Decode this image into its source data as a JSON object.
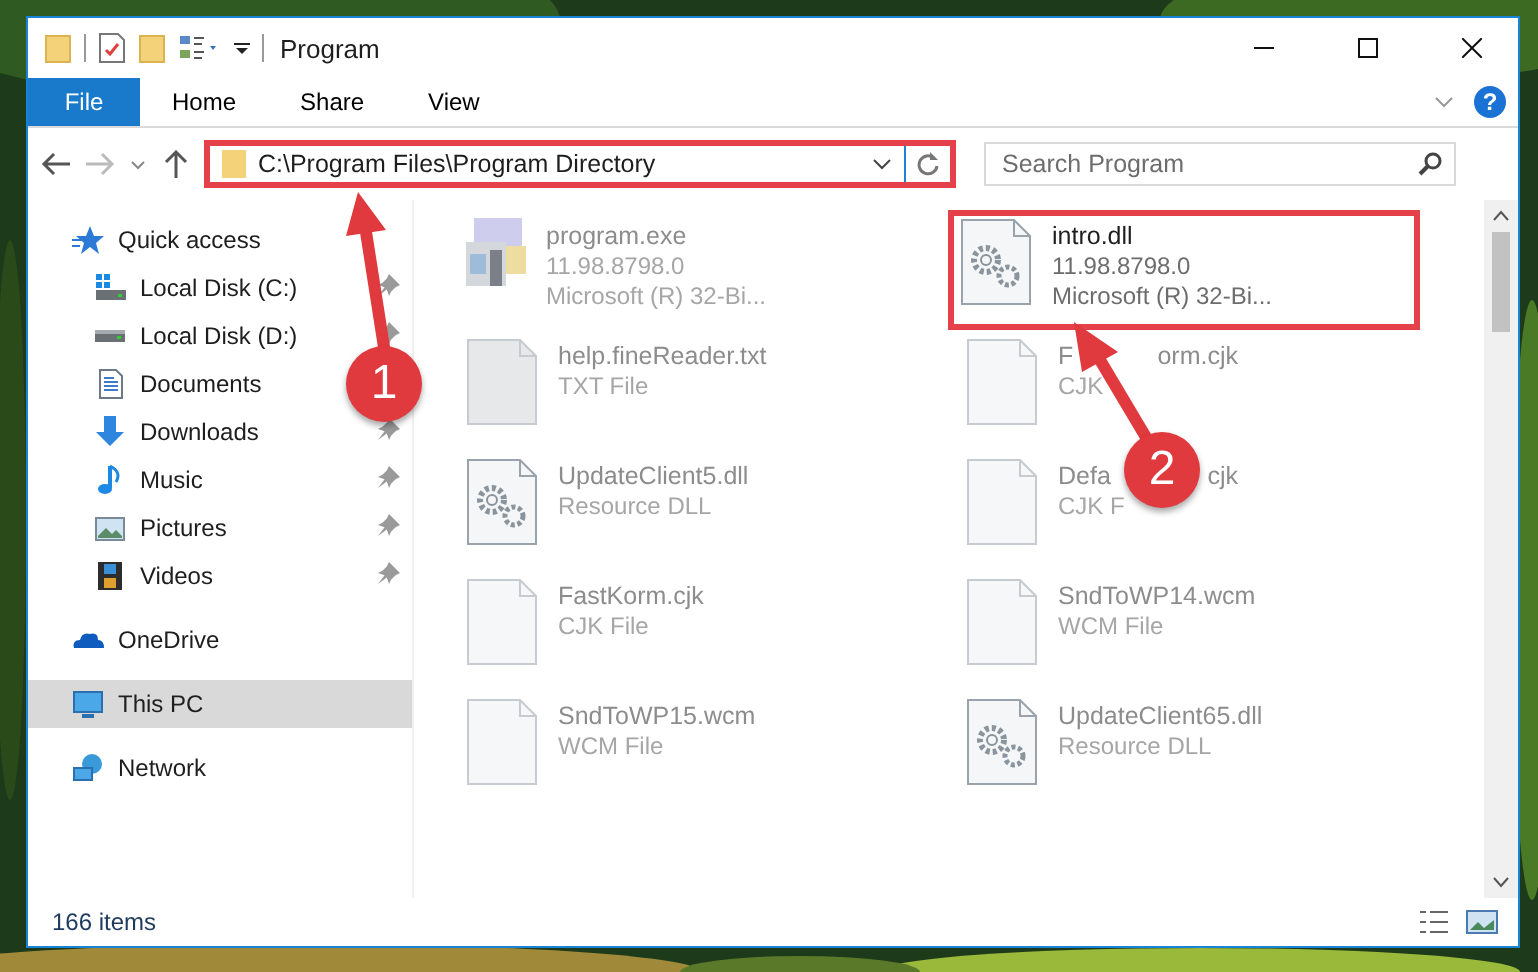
{
  "window": {
    "title": "Program"
  },
  "ribbon": {
    "tabs": [
      {
        "label": "File",
        "selected": true
      },
      {
        "label": "Home",
        "selected": false
      },
      {
        "label": "Share",
        "selected": false
      },
      {
        "label": "View",
        "selected": false
      }
    ],
    "help": "?"
  },
  "address_bar": {
    "path": "C:\\Program Files\\Program Directory",
    "highlighted": true
  },
  "search": {
    "placeholder": "Search Program"
  },
  "sidebar": {
    "items": [
      {
        "label": "Quick access",
        "kind": "star",
        "selected": false,
        "children": [
          {
            "label": "Local Disk (C:)",
            "kind": "windows-drive",
            "pinned": true,
            "selected": false
          },
          {
            "label": "Local Disk (D:)",
            "kind": "drive",
            "pinned": true,
            "selected": false
          },
          {
            "label": "Documents",
            "kind": "documents",
            "selected": false
          },
          {
            "label": "Downloads",
            "kind": "downloads",
            "pinned": true,
            "selected": false
          },
          {
            "label": "Music",
            "kind": "music",
            "pinned": true,
            "selected": false
          },
          {
            "label": "Pictures",
            "kind": "pictures",
            "pinned": true,
            "selected": false
          },
          {
            "label": "Videos",
            "kind": "videos",
            "pinned": true,
            "selected": false
          }
        ]
      },
      {
        "label": "OneDrive",
        "kind": "cloud",
        "selected": false
      },
      {
        "label": "This PC",
        "kind": "pc",
        "selected": true
      },
      {
        "label": "Network",
        "kind": "network",
        "selected": false
      }
    ]
  },
  "files": [
    {
      "name": [
        "program.exe"
      ],
      "kind": "app",
      "details": [
        "11.98.8798.0",
        "Microsoft (R) 32-Bi..."
      ],
      "highlighted": false
    },
    {
      "name": [
        "intro.dll"
      ],
      "kind": "gear",
      "details": [
        "11.98.8798.0",
        "Microsoft (R) 32-Bi..."
      ],
      "highlighted": true
    },
    {
      "name": [
        "help.fineReader.txt"
      ],
      "kind": "text",
      "details": [
        "TXT File"
      ],
      "highlighted": false
    },
    {
      "name": [
        "F",
        "orm.cjk"
      ],
      "kind": "blank",
      "details": [
        "CJK"
      ],
      "highlighted": false
    },
    {
      "name": [
        "UpdateClient5.dll"
      ],
      "kind": "gear",
      "details": [
        "Resource DLL"
      ],
      "highlighted": false
    },
    {
      "name": [
        "Defa",
        "cjk"
      ],
      "kind": "blank",
      "details": [
        "CJK F"
      ],
      "highlighted": false
    },
    {
      "name": [
        "FastKorm.cjk"
      ],
      "kind": "blank",
      "details": [
        "CJK File"
      ],
      "highlighted": false
    },
    {
      "name": [
        "SndToWP14.wcm"
      ],
      "kind": "blank",
      "details": [
        "WCM File"
      ],
      "highlighted": false
    },
    {
      "name": [
        "SndToWP15.wcm"
      ],
      "kind": "blank",
      "details": [
        "WCM File"
      ],
      "highlighted": false
    },
    {
      "name": [
        "UpdateClient65.dll"
      ],
      "kind": "gear",
      "details": [
        "Resource DLL"
      ],
      "highlighted": false
    }
  ],
  "callouts": [
    {
      "number": "1"
    },
    {
      "number": "2"
    }
  ],
  "status_bar": {
    "count": "166 items"
  }
}
